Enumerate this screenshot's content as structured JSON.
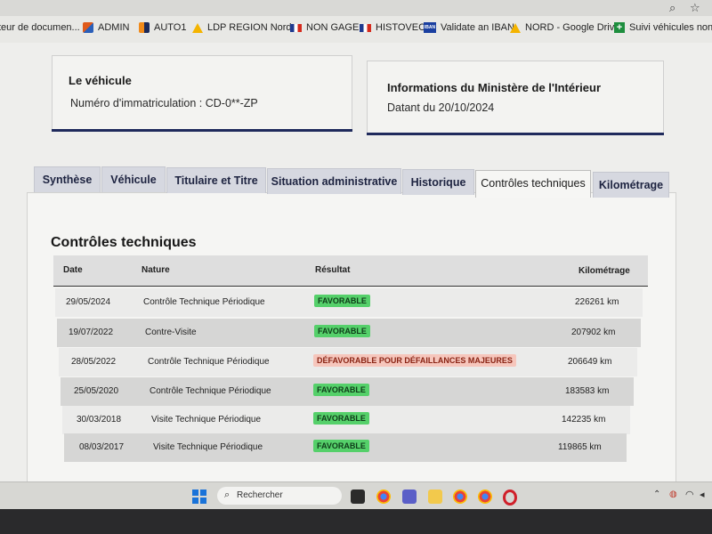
{
  "browser": {
    "star_icon": "star-icon",
    "search_icon": "search-icon"
  },
  "bookmarks": [
    {
      "label": "teur de documen...",
      "icon": "doc-icon"
    },
    {
      "label": "ADMIN",
      "icon": "admin-icon"
    },
    {
      "label": "AUTO1",
      "icon": "auto1-icon"
    },
    {
      "label": "LDP REGION Nord",
      "icon": "drive-icon"
    },
    {
      "label": "NON GAGE",
      "icon": "flag-icon"
    },
    {
      "label": "HISTOVEC",
      "icon": "flag-icon"
    },
    {
      "label": "Validate an IBAN",
      "icon": "iban-icon"
    },
    {
      "label": "NORD - Google Drive",
      "icon": "drive-icon"
    },
    {
      "label": "Suivi véhicules non...",
      "icon": "plus-icon"
    }
  ],
  "vehicle_card": {
    "title": "Le véhicule",
    "registration": "Numéro d'immatriculation : CD-0**-ZP"
  },
  "ministry_card": {
    "title": "Informations du Ministère de l'Intérieur",
    "date": "Datant du 20/10/2024"
  },
  "tabs": [
    {
      "label": "Synthèse",
      "active": false
    },
    {
      "label": "Véhicule",
      "active": false
    },
    {
      "label": "Titulaire et Titre",
      "active": false
    },
    {
      "label": "Situation administrative",
      "active": false
    },
    {
      "label": "Historique",
      "active": false
    },
    {
      "label": "Contrôles techniques",
      "active": true
    },
    {
      "label": "Kilométrage",
      "active": false
    }
  ],
  "section_title": "Contrôles techniques",
  "table": {
    "headers": [
      "Date",
      "Nature",
      "Résultat",
      "Kilométrage"
    ],
    "rows": [
      {
        "date": "29/05/2024",
        "nature": "Contrôle Technique Périodique",
        "result": "FAVORABLE",
        "status": "ok",
        "km": "226261 km"
      },
      {
        "date": "19/07/2022",
        "nature": "Contre-Visite",
        "result": "FAVORABLE",
        "status": "ok",
        "km": "207902 km"
      },
      {
        "date": "28/05/2022",
        "nature": "Contrôle Technique Périodique",
        "result": "DÉFAVORABLE POUR DÉFAILLANCES MAJEURES",
        "status": "bad",
        "km": "206649 km"
      },
      {
        "date": "25/05/2020",
        "nature": "Contrôle Technique Périodique",
        "result": "FAVORABLE",
        "status": "ok",
        "km": "183583 km"
      },
      {
        "date": "30/03/2018",
        "nature": "Visite Technique Périodique",
        "result": "FAVORABLE",
        "status": "ok",
        "km": "142235 km"
      },
      {
        "date": "08/03/2017",
        "nature": "Visite Technique Périodique",
        "result": "FAVORABLE",
        "status": "ok",
        "km": "119865 km"
      }
    ]
  },
  "taskbar": {
    "search_label": "Rechercher"
  },
  "colors": {
    "favorable": "#55d06a",
    "defavorable": "#f6c6bc",
    "tab_bg": "#d6d8e0",
    "card_accent": "#1f2a5c"
  }
}
